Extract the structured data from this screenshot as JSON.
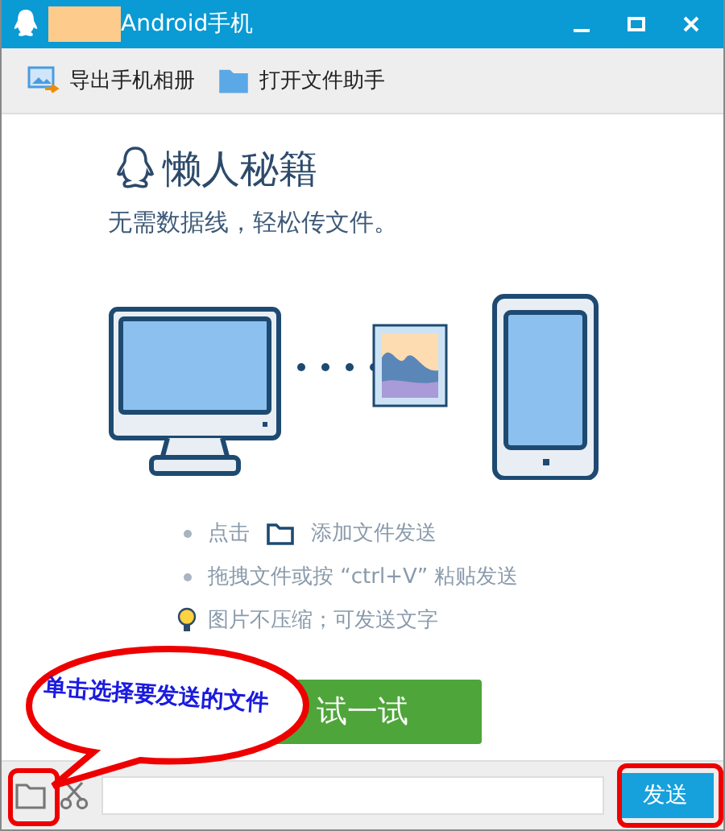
{
  "window": {
    "title": "Android手机"
  },
  "toolbar": [
    {
      "label": "导出手机相册",
      "kind": "export"
    },
    {
      "label": "打开文件助手",
      "kind": "folder"
    }
  ],
  "promo": {
    "heading": "懒人秘籍",
    "subtitle": "无需数据线，轻松传文件。",
    "tips": [
      {
        "kind": "folder",
        "text": "点击",
        "text_after": "添加文件发送"
      },
      {
        "kind": "bullet",
        "text": "拖拽文件或按 “ctrl+V” 粘贴发送"
      },
      {
        "kind": "bulb",
        "text": "图片不压缩；可发送文字"
      }
    ],
    "button": "试一试"
  },
  "send_button": "发送",
  "annotation": {
    "callout": "单击选择要发送的文件"
  }
}
